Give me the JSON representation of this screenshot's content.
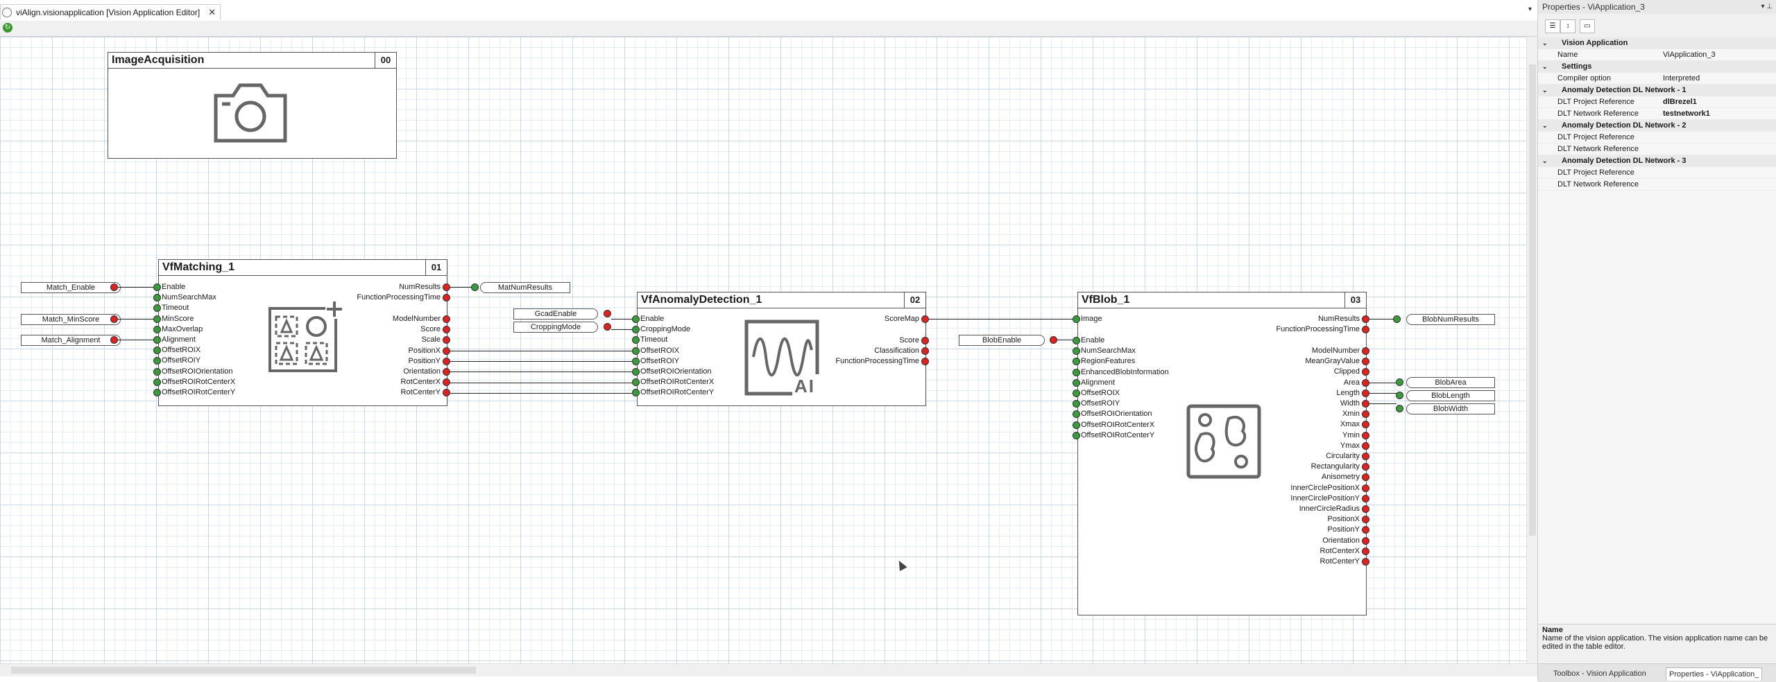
{
  "editor": {
    "tab_title": "viAlign.visionapplication [Vision Application Editor]",
    "close_glyph": "✕",
    "dropdown_glyph": "▾"
  },
  "blocks": {
    "image_acquisition": {
      "title": "ImageAcquisition",
      "num": "00",
      "icon": "camera-icon"
    },
    "vfmatching": {
      "title": "VfMatching_1",
      "num": "01",
      "icon": "matching-icon",
      "inputs": [
        "Enable",
        "NumSearchMax",
        "Timeout",
        "MinScore",
        "MaxOverlap",
        "Alignment",
        "OffsetROIX",
        "OffsetROIY",
        "OffsetROIOrientation",
        "OffsetROIRotCenterX",
        "OffsetROIRotCenterY"
      ],
      "outputs_top": [
        "NumResults",
        "FunctionProcessingTime"
      ],
      "outputs": [
        "ModelNumber",
        "Score",
        "Scale",
        "PositionX",
        "PositionY",
        "Orientation",
        "RotCenterX",
        "RotCenterY"
      ]
    },
    "vfanomaly": {
      "title": "VfAnomalyDetection_1",
      "num": "02",
      "icon": "ai-waveform-icon",
      "icon_text": "AI",
      "inputs": [
        "Enable",
        "CroppingMode",
        "Timeout",
        "OffsetROIX",
        "OffsetROIY",
        "OffsetROIOrientation",
        "OffsetROIRotCenterX",
        "OffsetROIRotCenterY"
      ],
      "outputs_top": [
        "ScoreMap"
      ],
      "outputs": [
        "Score",
        "Classification",
        "FunctionProcessingTime"
      ]
    },
    "vfblob": {
      "title": "VfBlob_1",
      "num": "03",
      "icon": "blob-icon",
      "inputs_top": [
        "Image"
      ],
      "inputs": [
        "Enable",
        "NumSearchMax",
        "RegionFeatures",
        "EnhancedBlobInformation",
        "Alignment",
        "OffsetROIX",
        "OffsetROIY",
        "OffsetROIOrientation",
        "OffsetROIRotCenterX",
        "OffsetROIRotCenterY"
      ],
      "outputs_top": [
        "NumResults",
        "FunctionProcessingTime"
      ],
      "outputs": [
        "ModelNumber",
        "MeanGrayValue",
        "Clipped",
        "Area",
        "Length",
        "Width",
        "Xmin",
        "Xmax",
        "Ymin",
        "Ymax",
        "Circularity",
        "Rectangularity",
        "Anisometry",
        "InnerCirclePositionX",
        "InnerCirclePositionY",
        "InnerCircleRadius",
        "PositionX",
        "PositionY",
        "Orientation",
        "RotCenterX",
        "RotCenterY"
      ]
    }
  },
  "variables": {
    "match_enable": "Match_Enable",
    "match_minscore": "Match_MinScore",
    "match_alignment": "Match_Alignment",
    "matnumresults": "MatNumResults",
    "gcadenable": "GcadEnable",
    "croppingmode": "CroppingMode",
    "blobenable": "BlobEnable",
    "blobnumresults": "BlobNumResults",
    "blobarea": "BlobArea",
    "bloblength": "BlobLength",
    "blobwidth": "BlobWidth"
  },
  "properties": {
    "header": "Properties - ViApplication_3",
    "rows": [
      {
        "type": "cat",
        "key": "Vision Application"
      },
      {
        "type": "prop",
        "key": "Name",
        "value": "ViApplication_3",
        "bold": false
      },
      {
        "type": "cat",
        "key": "Settings"
      },
      {
        "type": "prop",
        "key": "Compiler option",
        "value": "Interpreted",
        "bold": false
      },
      {
        "type": "cat",
        "key": "Anomaly Detection DL Network - 1"
      },
      {
        "type": "prop",
        "key": "DLT Project Reference",
        "value": "dlBrezel1",
        "bold": true
      },
      {
        "type": "prop",
        "key": "DLT Network Reference",
        "value": "testnetwork1",
        "bold": true
      },
      {
        "type": "cat",
        "key": "Anomaly Detection DL Network - 2"
      },
      {
        "type": "prop",
        "key": "DLT Project Reference",
        "value": "",
        "bold": false
      },
      {
        "type": "prop",
        "key": "DLT Network Reference",
        "value": "",
        "bold": false
      },
      {
        "type": "cat",
        "key": "Anomaly Detection DL Network - 3"
      },
      {
        "type": "prop",
        "key": "DLT Project Reference",
        "value": "",
        "bold": false
      },
      {
        "type": "prop",
        "key": "DLT Network Reference",
        "value": "",
        "bold": false
      }
    ],
    "desc_title": "Name",
    "desc_text": "Name of the vision application. The vision application name can be edited in the table editor.",
    "tab_toolbox": "Toolbox - Vision Application",
    "tab_properties": "Properties - ViApplication_"
  }
}
